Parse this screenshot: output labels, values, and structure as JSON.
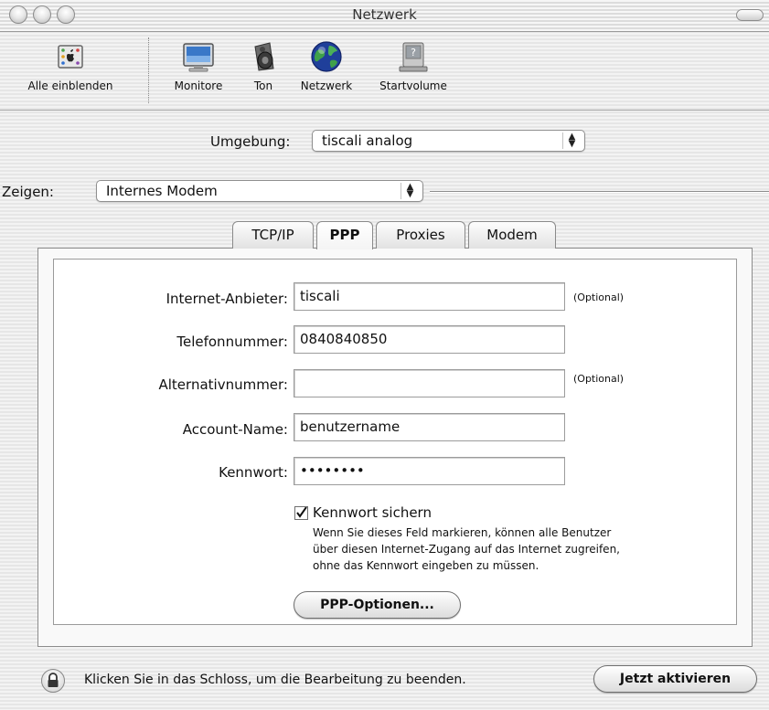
{
  "window": {
    "title": "Netzwerk"
  },
  "toolbar": {
    "items": [
      {
        "label": "Alle einblenden",
        "icon": "apple-grid-icon"
      },
      {
        "label": "Monitore",
        "icon": "monitor-icon"
      },
      {
        "label": "Ton",
        "icon": "speaker-icon"
      },
      {
        "label": "Netzwerk",
        "icon": "globe-icon"
      },
      {
        "label": "Startvolume",
        "icon": "disk-icon"
      }
    ]
  },
  "location": {
    "label": "Umgebung:",
    "value": "tiscali analog"
  },
  "show": {
    "label": "Zeigen:",
    "value": "Internes Modem"
  },
  "tabs": [
    {
      "label": "TCP/IP",
      "active": false
    },
    {
      "label": "PPP",
      "active": true
    },
    {
      "label": "Proxies",
      "active": false
    },
    {
      "label": "Modem",
      "active": false
    }
  ],
  "ppp": {
    "provider": {
      "label": "Internet-Anbieter:",
      "value": "tiscali",
      "note": "(Optional)"
    },
    "phone": {
      "label": "Telefonnummer:",
      "value": "0840840850"
    },
    "alt_phone": {
      "label": "Alternativnummer:",
      "value": "",
      "note": "(Optional)"
    },
    "account": {
      "label": "Account-Name:",
      "value": "benutzername"
    },
    "password": {
      "label": "Kennwort:",
      "value": "••••••••"
    },
    "save_password": {
      "label": "Kennwort sichern",
      "checked": true,
      "description": [
        "Wenn Sie dieses Feld markieren, können alle Benutzer",
        "über diesen Internet-Zugang auf das Internet zugreifen,",
        "ohne das Kennwort eingeben zu müssen."
      ]
    },
    "options_button": "PPP-Optionen..."
  },
  "footer": {
    "lock_text": "Klicken Sie in das Schloss, um die Bearbeitung zu beenden.",
    "apply_button": "Jetzt aktivieren"
  },
  "colors": {
    "accent_blue": "#2b6fd6",
    "border": "#8c8c8c"
  }
}
